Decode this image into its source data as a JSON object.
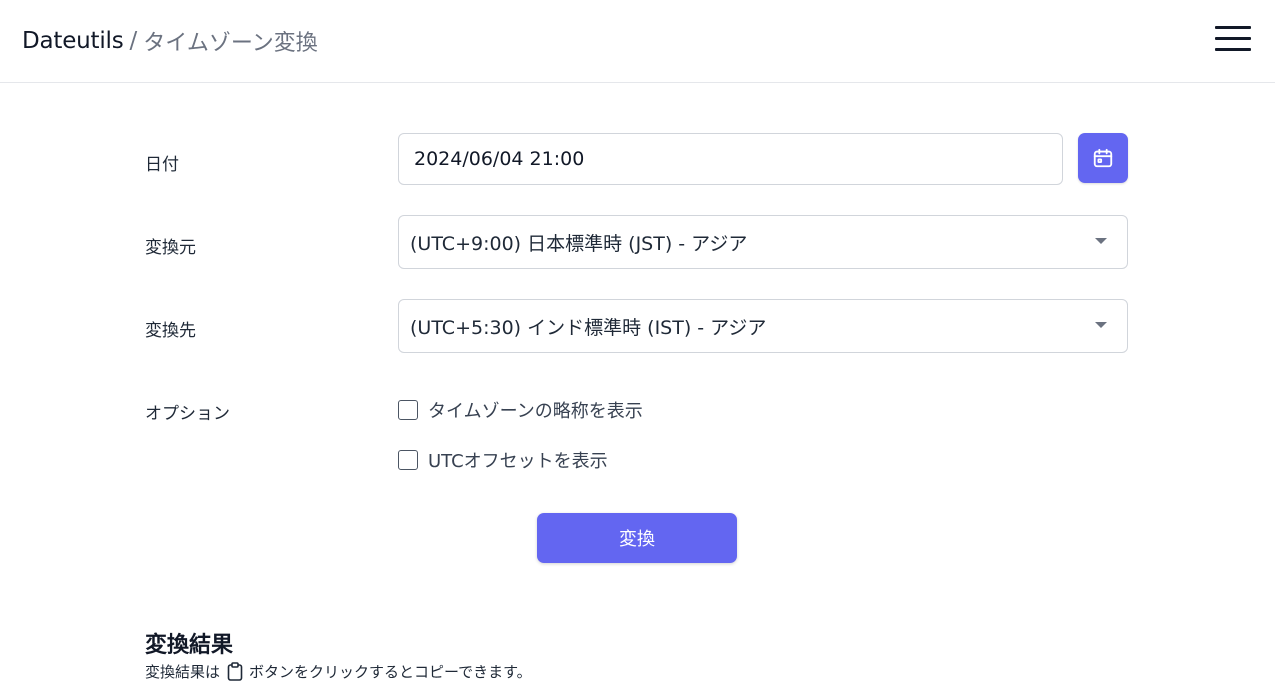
{
  "header": {
    "brand": "Dateutils",
    "separator": "/",
    "title": "タイムゾーン変換"
  },
  "form": {
    "date_label": "日付",
    "date_value": "2024/06/04 21:00",
    "from_label": "変換元",
    "from_value": "(UTC+9:00) 日本標準時 (JST) - アジア",
    "to_label": "変換先",
    "to_value": "(UTC+5:30) インド標準時 (IST) - アジア",
    "options_label": "オプション",
    "options": [
      {
        "label": "タイムゾーンの略称を表示",
        "checked": false
      },
      {
        "label": "UTCオフセットを表示",
        "checked": false
      }
    ],
    "convert_label": "変換"
  },
  "result": {
    "title": "変換結果",
    "desc_before": "変換結果は",
    "desc_after": "ボタンをクリックするとコピーできます。"
  },
  "icons": {
    "calendar": "calendar-icon",
    "menu": "hamburger-menu-icon",
    "clipboard": "clipboard-icon"
  },
  "colors": {
    "accent": "#6366f1",
    "border": "#d1d5db"
  }
}
